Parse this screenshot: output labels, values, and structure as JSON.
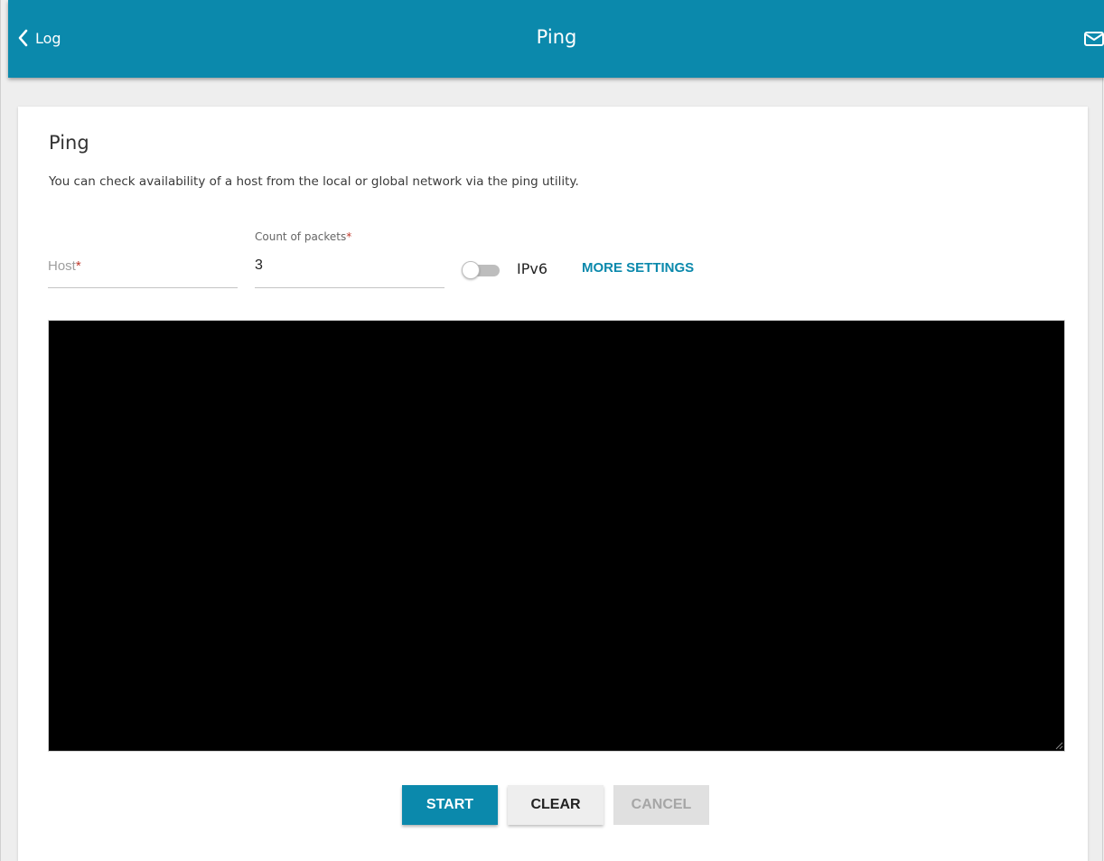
{
  "header": {
    "back_label": "Log",
    "title": "Ping",
    "back_icon": "chevron-left-icon",
    "mail_icon": "mail-icon"
  },
  "page": {
    "title": "Ping",
    "description": "You can check availability of a host from the local or global network via the ping utility."
  },
  "form": {
    "host": {
      "placeholder": "Host",
      "required_mark": "*",
      "value": ""
    },
    "count": {
      "label": "Count of packets",
      "required_mark": "*",
      "value": "3"
    },
    "ipv6": {
      "label": "IPv6",
      "enabled": false
    },
    "more_settings_label": "MORE SETTINGS"
  },
  "output": {
    "text": ""
  },
  "actions": {
    "start_label": "START",
    "clear_label": "CLEAR",
    "cancel_label": "CANCEL",
    "cancel_disabled": true
  },
  "colors": {
    "accent": "#0b89ac",
    "required": "#c0392b",
    "console_bg": "#000000"
  }
}
